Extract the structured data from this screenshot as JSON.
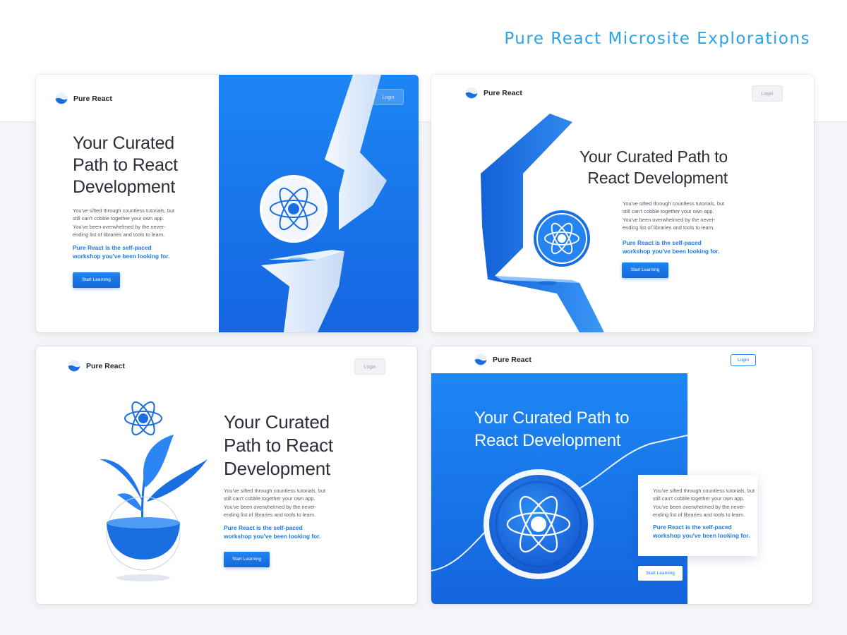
{
  "showcase_title": "Pure React Microsite Explorations",
  "brand": "Pure React",
  "login_label": "Login",
  "headline_lines_a": [
    "Your Curated",
    "Path to React",
    "Development"
  ],
  "headline_lines_b": [
    "Your Curated Path to",
    "React Development"
  ],
  "body_lines": [
    "You've sifted through countless tutorials, but",
    "still can't cobble together your own app.",
    "You've been overwhelmed by the never-",
    "ending list of libraries and tools to learn."
  ],
  "highlight_lines": [
    "Pure React is the self-paced",
    "workshop you've been looking for."
  ],
  "cta_label": "Start Learning",
  "colors": {
    "accent": "#1e7ae6",
    "title": "#2aa3e8",
    "blue_bg": "#1a7bf0"
  },
  "icons": {
    "logo": "logo-mark-icon",
    "atom": "react-atom-icon"
  }
}
